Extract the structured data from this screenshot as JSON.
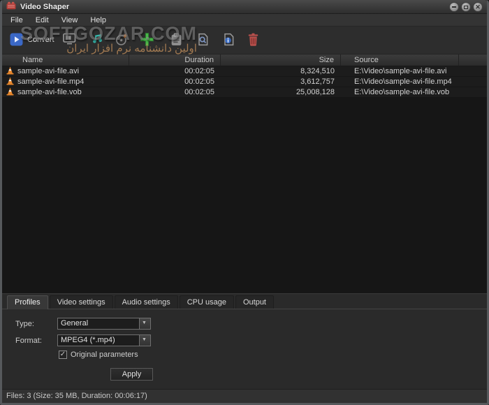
{
  "window": {
    "title": "Video Shaper",
    "controls": [
      {
        "name": "minimize"
      },
      {
        "name": "maximize"
      },
      {
        "name": "close"
      }
    ]
  },
  "menu": {
    "items": [
      "File",
      "Edit",
      "View",
      "Help"
    ]
  },
  "toolbar": {
    "convert": {
      "icon": "convert-icon",
      "label": "Convert"
    },
    "buttons": [
      {
        "icon": "add-video-icon"
      },
      {
        "icon": "add-audio-icon"
      },
      {
        "icon": "add-disc-icon"
      },
      {
        "icon": "add-files-icon"
      },
      {
        "icon": "paste-icon"
      },
      {
        "icon": "preview-icon"
      },
      {
        "icon": "file-info-icon"
      },
      {
        "icon": "delete-icon"
      }
    ]
  },
  "watermark": {
    "line1": "SOFTGOZAR.COM",
    "line2": "اولین دانشنامه نرم افزار ایران"
  },
  "table": {
    "columns": {
      "name": "Name",
      "duration": "Duration",
      "size": "Size",
      "source": "Source"
    },
    "rows": [
      {
        "name": "sample-avi-file.avi",
        "duration": "00:02:05",
        "size": "8,324,510",
        "source": "E:\\Video\\sample-avi-file.avi"
      },
      {
        "name": "sample-avi-file.mp4",
        "duration": "00:02:05",
        "size": "3,612,757",
        "source": "E:\\Video\\sample-avi-file.mp4"
      },
      {
        "name": "sample-avi-file.vob",
        "duration": "00:02:05",
        "size": "25,008,128",
        "source": "E:\\Video\\sample-avi-file.vob"
      }
    ]
  },
  "tabs": {
    "items": [
      "Profiles",
      "Video settings",
      "Audio settings",
      "CPU usage",
      "Output"
    ],
    "active": "Profiles"
  },
  "profiles": {
    "type_label": "Type:",
    "type_value": "General",
    "format_label": "Format:",
    "format_value": "MPEG4 (*.mp4)",
    "original_parameters_label": "Original parameters",
    "original_parameters_checked": true,
    "apply_label": "Apply"
  },
  "statusbar": {
    "text": "Files: 3 (Size: 35 MB, Duration: 00:06:17)"
  },
  "colors": {
    "accent_blue": "#3b68c6",
    "add_green": "#49b749",
    "audio_teal": "#35b8ac",
    "cone_orange": "#e8862a",
    "delete_red": "#b8504c",
    "window_bg": "#2a2a2a"
  }
}
